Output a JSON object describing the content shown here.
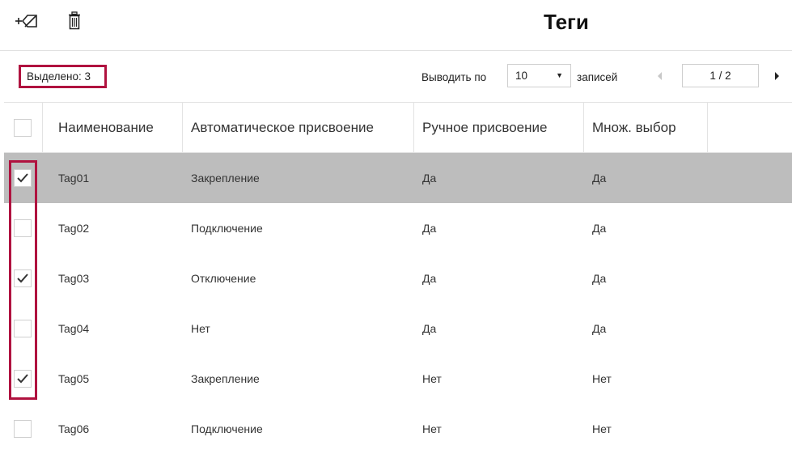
{
  "header": {
    "title": "Теги"
  },
  "selection": {
    "label": "Выделено: 3"
  },
  "pager": {
    "show_label": "Выводить по",
    "page_size": "10",
    "records_label": "записей",
    "page": "1 / 2"
  },
  "columns": [
    {
      "label": "Наименование"
    },
    {
      "label": "Автоматическое присвоение"
    },
    {
      "label": "Ручное присвоение"
    },
    {
      "label": "Множ. выбор"
    }
  ],
  "rows": [
    {
      "name": "Tag01",
      "auto": "Закрепление",
      "manual": "Да",
      "multi": "Да",
      "checked": true,
      "highlighted": true
    },
    {
      "name": "Tag02",
      "auto": "Подключение",
      "manual": "Да",
      "multi": "Да",
      "checked": false,
      "highlighted": false
    },
    {
      "name": "Tag03",
      "auto": "Отключение",
      "manual": "Да",
      "multi": "Да",
      "checked": true,
      "highlighted": false
    },
    {
      "name": "Tag04",
      "auto": "Нет",
      "manual": "Да",
      "multi": "Да",
      "checked": false,
      "highlighted": false
    },
    {
      "name": "Tag05",
      "auto": "Закрепление",
      "manual": "Нет",
      "multi": "Нет",
      "checked": true,
      "highlighted": false
    },
    {
      "name": "Tag06",
      "auto": "Подключение",
      "manual": "Нет",
      "multi": "Нет",
      "checked": false,
      "highlighted": false
    }
  ],
  "icons": {
    "add_tag": "add-tag-icon",
    "delete": "trash-icon",
    "prev": "chevron-left-icon",
    "next": "chevron-right-icon",
    "dropdown": "caret-down-icon"
  },
  "colors": {
    "highlight": "#b0123f",
    "selected_row": "#bdbdbd"
  }
}
